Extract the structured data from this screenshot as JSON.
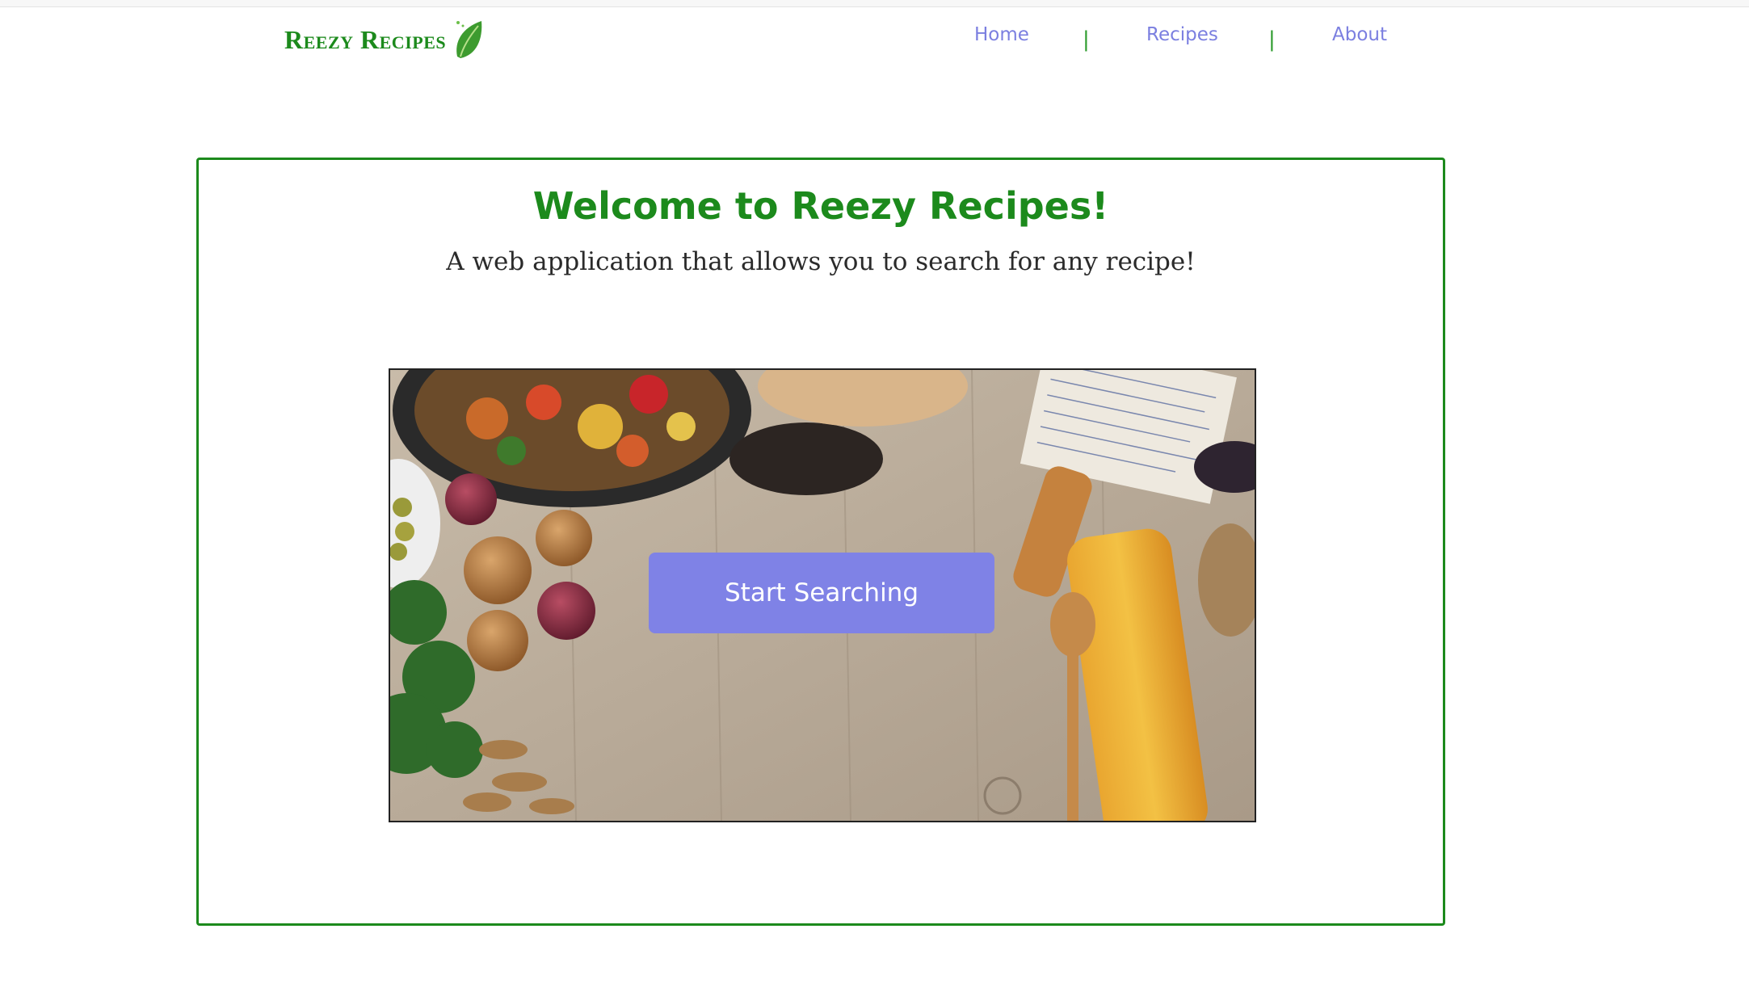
{
  "brand": {
    "name": "Reezy Recipes",
    "icon": "leaf-icon"
  },
  "nav": {
    "items": [
      {
        "label": "Home"
      },
      {
        "label": "Recipes"
      },
      {
        "label": "About"
      }
    ],
    "separator": "|"
  },
  "hero": {
    "title": "Welcome to Reezy Recipes!",
    "subtitle": "A web application that allows you to search for any recipe!",
    "button_label": "Start Searching"
  },
  "colors": {
    "brand_green": "#1c8a1c",
    "nav_link": "#7b7fe0",
    "button_bg": "#7f82e6",
    "wood": "#b9aa98"
  }
}
